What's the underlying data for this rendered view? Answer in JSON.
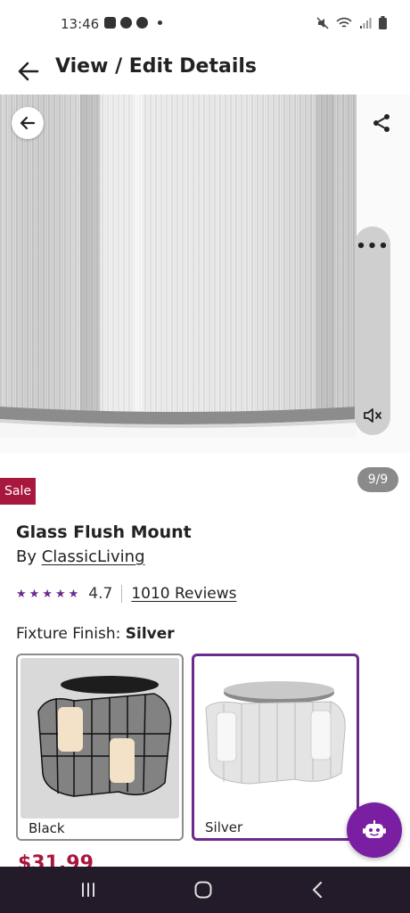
{
  "status_bar": {
    "time": "13:46",
    "left_icons": [
      "gallery-icon",
      "camera-icon",
      "whatsapp-icon",
      "dot-icon"
    ],
    "right_icons": [
      "mute-icon",
      "wifi-icon",
      "signal-icon",
      "battery-icon"
    ]
  },
  "header": {
    "title": "View / Edit Details"
  },
  "gallery": {
    "counter": "9/9",
    "badge": "Sale",
    "dots": "•••"
  },
  "product": {
    "title": "Glass Flush Mount",
    "by_prefix": "By ",
    "brand": "ClassicLiving",
    "stars": "★★★★★",
    "rating": "4.7",
    "reviews": "1010 Reviews"
  },
  "finish": {
    "label": "Fixture Finish: ",
    "selected": "Silver",
    "options": [
      {
        "label": "Black"
      },
      {
        "label": "Silver"
      }
    ]
  },
  "price_peek": "$31.99",
  "colors": {
    "accent": "#6b2a8c",
    "sale": "#a8173e",
    "assistant": "#7b1fa2",
    "nav": "#241b2a"
  }
}
